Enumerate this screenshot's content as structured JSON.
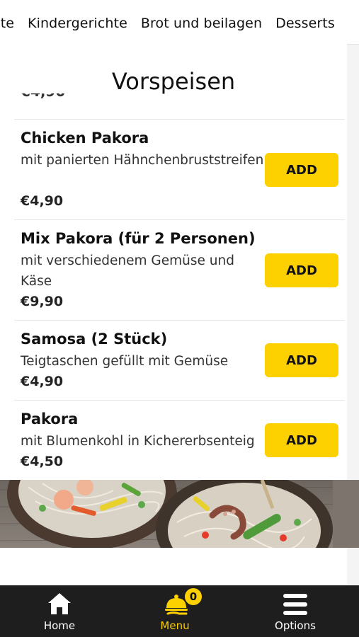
{
  "category_tabs": [
    "chte",
    "Kindergerichte",
    "Brot und beilagen",
    "Desserts"
  ],
  "section": {
    "title": "Vorspeisen",
    "peek_price": "€4,90"
  },
  "items": [
    {
      "name": "Chicken Pakora",
      "description": "mit panierten Hähnchenbruststreifen",
      "price": "€4,90",
      "add_label": "ADD"
    },
    {
      "name": "Mix Pakora (für 2 Personen)",
      "description": "mit verschiedenem Gemüse und Käse",
      "price": "€9,90",
      "add_label": "ADD"
    },
    {
      "name": "Samosa (2 Stück)",
      "description": "Teigtaschen gefüllt mit Gemüse",
      "price": "€4,90",
      "add_label": "ADD"
    },
    {
      "name": "Pakora",
      "description": "mit Blumenkohl in Kichererbsenteig",
      "price": "€4,50",
      "add_label": "ADD"
    }
  ],
  "bottom_nav": {
    "home": {
      "label": "Home",
      "icon": "home-icon"
    },
    "menu": {
      "label": "Menu",
      "icon": "cloche-icon",
      "badge": "0"
    },
    "options": {
      "label": "Options",
      "icon": "hamburger-menu-icon"
    }
  },
  "colors": {
    "accent": "#fdd100",
    "nav_background": "#1e1e1e",
    "nav_text": "#ffffff",
    "active_nav_text": "#fdd100"
  }
}
